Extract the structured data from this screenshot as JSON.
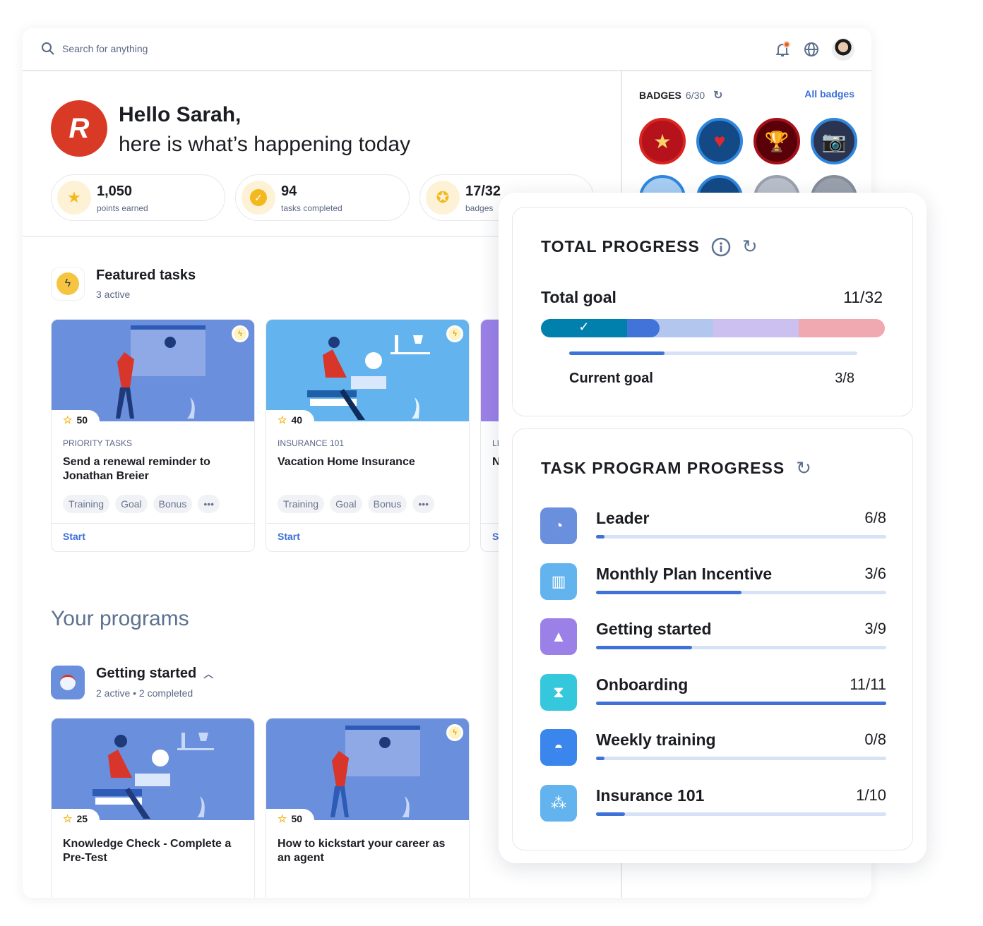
{
  "header": {
    "search_placeholder": "Search for anything",
    "icons": [
      "search-icon",
      "bell-icon",
      "globe-icon",
      "avatar"
    ],
    "notification_dot_color": "#e0622b"
  },
  "greeting": {
    "line1": "Hello Sarah,",
    "line2": "here is what’s happening today",
    "logo_letter": "R"
  },
  "stats": [
    {
      "value": "1,050",
      "label": "points earned",
      "icon": "star-icon"
    },
    {
      "value": "94",
      "label": "tasks completed",
      "icon": "check-circle-icon"
    },
    {
      "value": "17/32",
      "label": "badges",
      "icon": "ribbon-icon"
    }
  ],
  "featured": {
    "title": "Featured tasks",
    "subtitle": "3 active",
    "cards": [
      {
        "points": "50",
        "category": "PRIORITY TASKS",
        "title": "Send a renewal reminder to Jonathan Breier",
        "tags": [
          "Training",
          "Goal",
          "Bonus"
        ],
        "action": "Start",
        "image_color": "#6a8fdc"
      },
      {
        "points": "40",
        "category": "INSURANCE 101",
        "title": "Vacation Home Insurance",
        "tags": [
          "Training",
          "Goal",
          "Bonus"
        ],
        "action": "Start",
        "image_color": "#63b4ee"
      },
      {
        "points": "",
        "category": "LI",
        "title": "N",
        "action": "S",
        "image_color": "#9b80e8"
      }
    ]
  },
  "programs": {
    "title": "Your programs",
    "group": {
      "title": "Getting started",
      "subtitle": "2 active • 2 completed"
    },
    "cards": [
      {
        "points": "25",
        "title": "Knowledge Check - Complete a Pre-Test",
        "image_color": "#6a8fdc"
      },
      {
        "points": "50",
        "title": "How to kickstart your career as an agent",
        "image_color": "#6a8fdc"
      }
    ]
  },
  "badges": {
    "label": "BADGES",
    "count": "6/30",
    "all_link": "All badges",
    "items": [
      {
        "name": "stars",
        "bg": "#b5121b",
        "ring": "#d9241f",
        "glyph": "★"
      },
      {
        "name": "heart",
        "bg": "#134a86",
        "ring": "#2f86dc",
        "glyph": "♥"
      },
      {
        "name": "trophy",
        "bg": "#5a0008",
        "ring": "#a3101a",
        "glyph": "🏆"
      },
      {
        "name": "camera",
        "bg": "#2a3350",
        "ring": "#2f86dc",
        "glyph": "📷"
      },
      {
        "name": "b5",
        "bg": "#a7cdf2",
        "ring": "#2f86dc",
        "glyph": ""
      },
      {
        "name": "b6",
        "bg": "#134a86",
        "ring": "#2f86dc",
        "glyph": ""
      },
      {
        "name": "locked",
        "bg": "#b9bfca",
        "ring": "#9aa1ad",
        "glyph": ""
      },
      {
        "name": "locked",
        "bg": "#9aa1ad",
        "ring": "#868d99",
        "glyph": ""
      }
    ]
  },
  "total_progress": {
    "title": "TOTAL PROGRESS",
    "total_label": "Total goal",
    "total_value": "11/32",
    "segments": [
      {
        "color": "#0180ad",
        "status": "completed"
      },
      {
        "color": "#b3c6ee",
        "status": "current",
        "progress_color": "#4273d9"
      },
      {
        "color": "#cbc0f0",
        "status": "upcoming"
      },
      {
        "color": "#f0a9b0",
        "status": "upcoming"
      }
    ],
    "current_label": "Current goal",
    "current_value": "3/8",
    "current_fraction": 0.33
  },
  "task_program_progress": {
    "title": "TASK PROGRAM PROGRESS",
    "items": [
      {
        "name": "Leader",
        "value": "6/8",
        "fraction": 0.03,
        "icon_bg": "#6a8fdc",
        "icon": "gauge-icon"
      },
      {
        "name": "Monthly Plan Incentive",
        "value": "3/6",
        "fraction": 0.5,
        "icon_bg": "#63b4ee",
        "icon": "chart-icon"
      },
      {
        "name": "Getting started",
        "value": "3/9",
        "fraction": 0.33,
        "icon_bg": "#9b80e8",
        "icon": "pyramid-icon"
      },
      {
        "name": "Onboarding",
        "value": "11/11",
        "fraction": 1.0,
        "icon_bg": "#35c7dc",
        "icon": "hourglass-icon"
      },
      {
        "name": "Weekly training",
        "value": "0/8",
        "fraction": 0.03,
        "icon_bg": "#3a86ec",
        "icon": "speedometer-icon"
      },
      {
        "name": "Insurance 101",
        "value": "1/10",
        "fraction": 0.1,
        "icon_bg": "#63b4ee",
        "icon": "team-icon"
      }
    ]
  }
}
